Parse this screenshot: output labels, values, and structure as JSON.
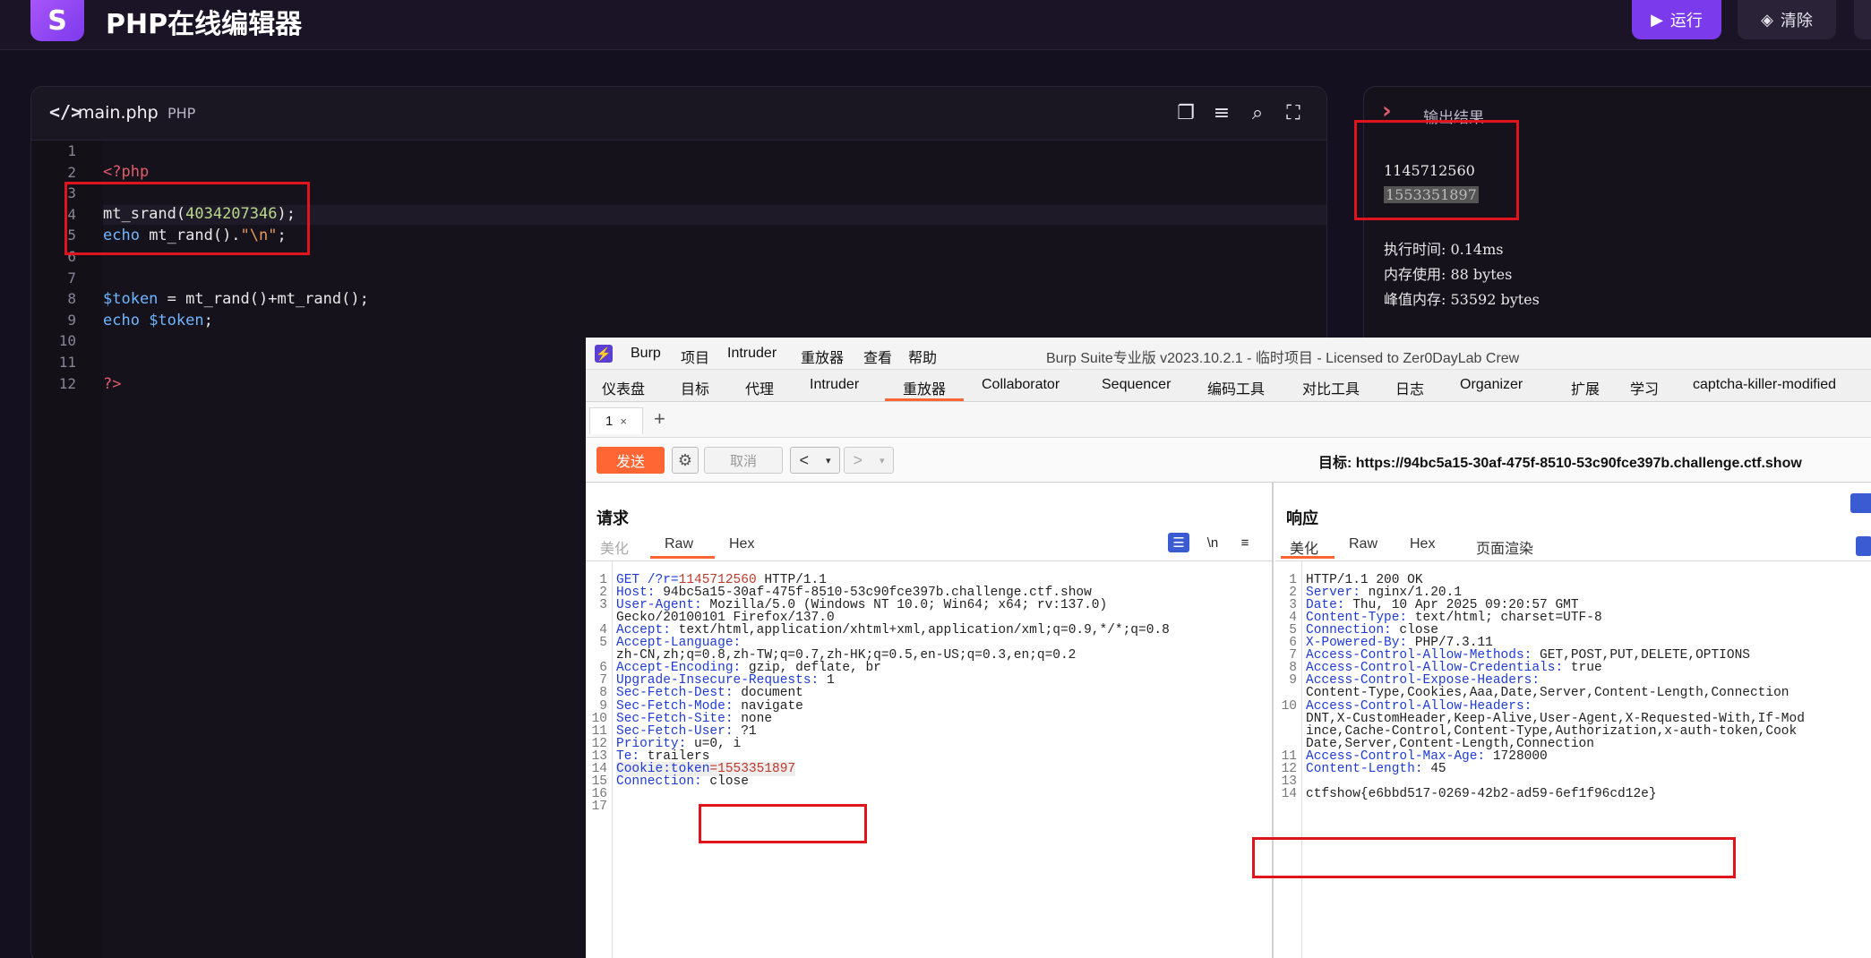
{
  "app": {
    "title": "PHP在线编辑器",
    "logo_icon": "S",
    "run_label": "运行",
    "clear_label": "清除",
    "accent": "#7c3aed"
  },
  "editor": {
    "file_name": "main.php",
    "file_lang": "PHP",
    "line_numbers": [
      "1",
      "2",
      "3",
      "4",
      "5",
      "6",
      "7",
      "8",
      "9",
      "10",
      "11",
      "12"
    ],
    "code": {
      "l2": "<?php",
      "l4_fn": "mt_srand(",
      "l4_num": "4034207346",
      "l4_end": ");",
      "l5_kw": "echo",
      "l5_fn": " mt_rand().",
      "l5_str": "\"\\n\"",
      "l5_end": ";",
      "l8_var": "$token",
      "l8_rest": " = mt_rand()+mt_rand();",
      "l9_kw": "echo",
      "l9_var": " $token",
      "l9_end": ";",
      "l12": "?>"
    }
  },
  "output": {
    "title": "输出结果",
    "line1": "1145712560",
    "line2": "1553351897",
    "exec_time": "执行时间: 0.14ms",
    "mem_use": "内存使用: 88 bytes",
    "peak_mem": "峰值内存: 53592 bytes"
  },
  "burp": {
    "menu": [
      "Burp",
      "项目",
      "Intruder",
      "重放器",
      "查看",
      "帮助"
    ],
    "window_title": "Burp Suite专业版  v2023.10.2.1 - 临时项目 - Licensed to Zer0DayLab Crew",
    "tabs": [
      "仪表盘",
      "目标",
      "代理",
      "Intruder",
      "重放器",
      "Collaborator",
      "Sequencer",
      "编码工具",
      "对比工具",
      "日志",
      "Organizer",
      "扩展",
      "学习",
      "captcha-killer-modified"
    ],
    "repeater_tab": "1",
    "repeater_tab_close": "×",
    "add_tab": "+",
    "send_label": "发送",
    "cancel_label": "取消",
    "target_label": "目标: ",
    "target_url": "https://94bc5a15-30af-475f-8510-53c90fce397b.challenge.ctf.show",
    "request": {
      "title": "请求",
      "subtabs": [
        "美化",
        "Raw",
        "Hex"
      ],
      "newline_label": "\\n",
      "lines": [
        {
          "n": "1",
          "k": "GET /?r=",
          "v": "1145712560",
          "rest": " HTTP/1.1"
        },
        {
          "n": "2",
          "k": "Host:",
          "v": " 94bc5a15-30af-475f-8510-53c90fce397b.challenge.ctf.show"
        },
        {
          "n": "3",
          "k": "User-Agent:",
          "v": " Mozilla/5.0 (Windows NT 10.0; Win64; x64; rv:137.0)"
        },
        {
          "n": "",
          "k": "",
          "v": "Gecko/20100101 Firefox/137.0"
        },
        {
          "n": "4",
          "k": "Accept:",
          "v": " text/html,application/xhtml+xml,application/xml;q=0.9,*/*;q=0.8"
        },
        {
          "n": "5",
          "k": "Accept-Language:",
          "v": ""
        },
        {
          "n": "",
          "k": "",
          "v": "zh-CN,zh;q=0.8,zh-TW;q=0.7,zh-HK;q=0.5,en-US;q=0.3,en;q=0.2"
        },
        {
          "n": "6",
          "k": "Accept-Encoding:",
          "v": " gzip, deflate, br"
        },
        {
          "n": "7",
          "k": "Upgrade-Insecure-Requests:",
          "v": " 1"
        },
        {
          "n": "8",
          "k": "Sec-Fetch-Dest:",
          "v": " document"
        },
        {
          "n": "9",
          "k": "Sec-Fetch-Mode:",
          "v": " navigate"
        },
        {
          "n": "10",
          "k": "Sec-Fetch-Site:",
          "v": " none"
        },
        {
          "n": "11",
          "k": "Sec-Fetch-User:",
          "v": " ?1"
        },
        {
          "n": "12",
          "k": "Priority:",
          "v": " u=0, i"
        },
        {
          "n": "13",
          "k": "Te:",
          "v": " trailers"
        },
        {
          "n": "14",
          "k": "Cookie:token",
          "v": "=1553351897"
        },
        {
          "n": "15",
          "k": "Connection:",
          "v": " close"
        },
        {
          "n": "16",
          "k": "",
          "v": ""
        },
        {
          "n": "17",
          "k": "",
          "v": ""
        }
      ]
    },
    "response": {
      "title": "响应",
      "subtabs": [
        "美化",
        "Raw",
        "Hex",
        "页面渲染"
      ],
      "lines": [
        {
          "n": "1",
          "k": "",
          "v": "HTTP/1.1 200 OK"
        },
        {
          "n": "2",
          "k": "Server:",
          "v": " nginx/1.20.1"
        },
        {
          "n": "3",
          "k": "Date:",
          "v": " Thu, 10 Apr 2025 09:20:57 GMT"
        },
        {
          "n": "4",
          "k": "Content-Type:",
          "v": " text/html; charset=UTF-8"
        },
        {
          "n": "5",
          "k": "Connection:",
          "v": " close"
        },
        {
          "n": "6",
          "k": "X-Powered-By:",
          "v": " PHP/7.3.11"
        },
        {
          "n": "7",
          "k": "Access-Control-Allow-Methods:",
          "v": " GET,POST,PUT,DELETE,OPTIONS"
        },
        {
          "n": "8",
          "k": "Access-Control-Allow-Credentials:",
          "v": " true"
        },
        {
          "n": "9",
          "k": "Access-Control-Expose-Headers:",
          "v": ""
        },
        {
          "n": "",
          "k": "",
          "v": "Content-Type,Cookies,Aaa,Date,Server,Content-Length,Connection"
        },
        {
          "n": "10",
          "k": "Access-Control-Allow-Headers:",
          "v": ""
        },
        {
          "n": "",
          "k": "",
          "v": "DNT,X-CustomHeader,Keep-Alive,User-Agent,X-Requested-With,If-Mod"
        },
        {
          "n": "",
          "k": "",
          "v": "ince,Cache-Control,Content-Type,Authorization,x-auth-token,Cook"
        },
        {
          "n": "",
          "k": "",
          "v": "Date,Server,Content-Length,Connection"
        },
        {
          "n": "11",
          "k": "Access-Control-Max-Age:",
          "v": " 1728000"
        },
        {
          "n": "12",
          "k": "Content-Length:",
          "v": " 45"
        },
        {
          "n": "13",
          "k": "",
          "v": ""
        },
        {
          "n": "14",
          "k": "",
          "v": "ctfshow{e6bbd517-0269-42b2-ad59-6ef1f96cd12e}"
        }
      ]
    }
  }
}
